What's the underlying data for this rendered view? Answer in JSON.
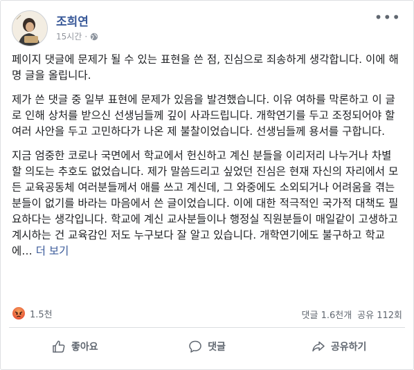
{
  "post": {
    "author": "조희연",
    "time": "15시간",
    "privacy_icon": "globe-icon",
    "more_icon": "more-icon",
    "paragraphs": [
      "페이지 댓글에 문제가 될 수 있는 표현을 쓴 점, 진심으로 죄송하게 생각합니다. 이에 해명 글을 올립니다.",
      "제가 쓴 댓글 중 일부 표현에 문제가 있음을 발견했습니다. 이유 여하를 막론하고 이 글로 인해 상처를 받으신 선생님들께 깊이 사과드립니다. 개학연기를 두고 조정되어야 할 여러 사안을 두고 고민하다가 나온 제 불찰이었습니다. 선생님들께 용서를 구합니다.",
      "지금 엄중한 코로나 국면에서 학교에서 헌신하고 계신 분들을 이리저리 나누거나 차별할 의도는 추호도 없었습니다. 제가 말씀드리고 싶었던 진심은 현재 자신의 자리에서 모든 교육공동체 여러분들께서 애를 쓰고 계신데, 그 와중에도 소외되거나 어려움을 겪는 분들이 없기를 바라는 마음에서 쓴 글이었습니다. 이에 대한 적극적인 국가적 대책도 필요하다는 생각입니다. 학교에 계신 교사분들이나 행정실 직원분들이 매일같이 고생하고 계시하는 건 교육감인 저도 누구보다 잘 알고 있습니다. 개학연기에도 불구하고 학교에…"
    ],
    "see_more": "더 보기"
  },
  "stats": {
    "reaction_icon": "angry-reaction-icon",
    "reaction_count": "1.5천",
    "comments": "댓글 1.6천개",
    "shares": "공유 112회"
  },
  "actions": {
    "like": "좋아요",
    "comment": "댓글",
    "share": "공유하기"
  }
}
